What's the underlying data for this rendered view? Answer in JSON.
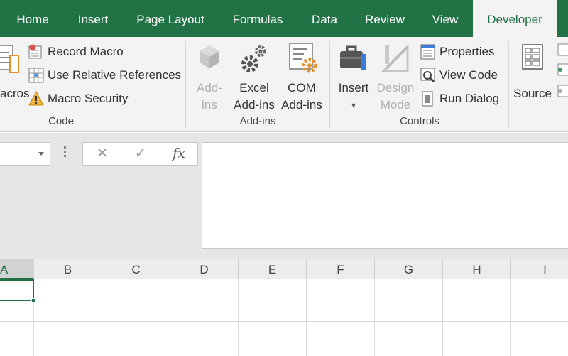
{
  "tabs": [
    {
      "label": "Home"
    },
    {
      "label": "Insert"
    },
    {
      "label": "Page Layout"
    },
    {
      "label": "Formulas"
    },
    {
      "label": "Data"
    },
    {
      "label": "Review"
    },
    {
      "label": "View"
    },
    {
      "label": "Developer",
      "active": true
    }
  ],
  "code_group": {
    "label": "Code",
    "macros_label": "acros",
    "record_macro": "Record Macro",
    "relative_refs": "Use Relative References",
    "macro_security": "Macro Security"
  },
  "addins_group": {
    "label": "Add-ins",
    "addins_line1": "Add-",
    "addins_line2": "ins",
    "excel_line1": "Excel",
    "excel_line2": "Add-ins",
    "com_line1": "COM",
    "com_line2": "Add-ins"
  },
  "controls_group": {
    "label": "Controls",
    "insert": "Insert",
    "design_line1": "Design",
    "design_line2": "Mode",
    "properties": "Properties",
    "view_code": "View Code",
    "run_dialog": "Run Dialog"
  },
  "xml_group": {
    "source": "Source"
  },
  "formula_bar": {
    "cancel": "✕",
    "enter": "✓",
    "fx": "fx",
    "value": ""
  },
  "columns": [
    "A",
    "B",
    "C",
    "D",
    "E",
    "F",
    "G",
    "H",
    "I"
  ],
  "selected_column": "A",
  "colors": {
    "accent": "#217346",
    "ribbon_bg": "#f3f3f3",
    "icon_orange": "#e8922f"
  }
}
